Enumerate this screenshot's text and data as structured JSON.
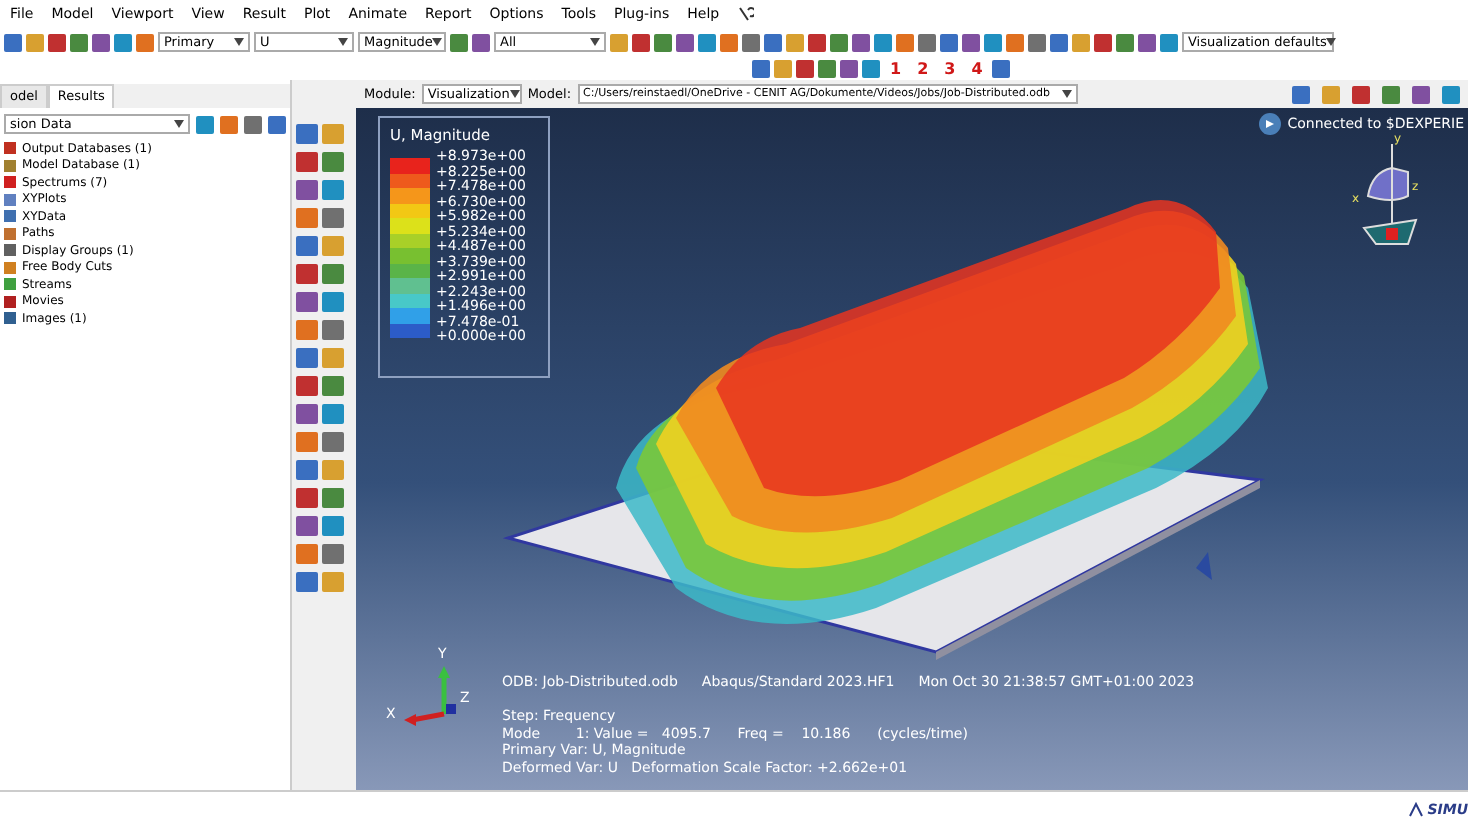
{
  "menu": [
    "File",
    "Model",
    "Viewport",
    "View",
    "Result",
    "Plot",
    "Animate",
    "Report",
    "Options",
    "Tools",
    "Plug-ins",
    "Help"
  ],
  "toolbar": {
    "step_select": "Primary",
    "variable_select": "U",
    "invariant_select": "Magnitude",
    "selection_select": "All",
    "defaults_select": "Visualization defaults",
    "view_numbers": [
      "1",
      "2",
      "3",
      "4"
    ]
  },
  "context_bar": {
    "module_label": "Module:",
    "module": "Visualization",
    "model_label": "Model:",
    "model": "C:/Users/reinstaedl/OneDrive - CENIT AG/Dokumente/Videos/Jobs/Job-Distributed.odb"
  },
  "tabs": [
    {
      "label": "odel",
      "selected": false
    },
    {
      "label": "Results",
      "selected": true
    }
  ],
  "tree_filter": "sion Data",
  "tree": [
    {
      "label": "Output Databases (1)",
      "color": "#c03020"
    },
    {
      "label": "Model Database (1)",
      "color": "#a08030"
    },
    {
      "label": "Spectrums (7)",
      "color": "#d02020"
    },
    {
      "label": "XYPlots",
      "color": "#6080c0"
    },
    {
      "label": "XYData",
      "color": "#4070b0"
    },
    {
      "label": "Paths",
      "color": "#c07030"
    },
    {
      "label": "Display Groups (1)",
      "color": "#606060"
    },
    {
      "label": "Free Body Cuts",
      "color": "#d08020"
    },
    {
      "label": "Streams",
      "color": "#40a040"
    },
    {
      "label": "Movies",
      "color": "#b02020"
    },
    {
      "label": "Images (1)",
      "color": "#306090"
    }
  ],
  "viewport": {
    "legend": {
      "title": "U, Magnitude",
      "values": [
        "+8.973e+00",
        "+8.225e+00",
        "+7.478e+00",
        "+6.730e+00",
        "+5.982e+00",
        "+5.234e+00",
        "+4.487e+00",
        "+3.739e+00",
        "+2.991e+00",
        "+2.243e+00",
        "+1.496e+00",
        "+7.478e-01",
        "+0.000e+00"
      ],
      "bands": [
        {
          "color": "#e8231c"
        },
        {
          "color": "#ee5a1c"
        },
        {
          "color": "#f5961a"
        },
        {
          "color": "#f2c814"
        },
        {
          "color": "#dce11a"
        },
        {
          "color": "#a8d028"
        },
        {
          "color": "#78c030"
        },
        {
          "color": "#5ab448"
        },
        {
          "color": "#60c090"
        },
        {
          "color": "#48c8c8"
        },
        {
          "color": "#30a0e8"
        },
        {
          "color": "#2c5cc8"
        }
      ]
    },
    "connection": "Connected to $DEXPERIE",
    "view_cube_axes": [
      "x",
      "y",
      "z"
    ],
    "triad_axes": [
      "Y",
      "X",
      "Z"
    ],
    "info": {
      "odb": "ODB: Job-Distributed.odb",
      "solver": "Abaqus/Standard 2023.HF1",
      "date": "Mon Oct 30 21:38:57 GMT+01:00 2023",
      "step": "Step: Frequency",
      "mode": "Mode        1: Value =   4095.7      Freq =    10.186      (cycles/time)",
      "primary": "Primary Var: U, Magnitude",
      "deformed": "Deformed Var: U   Deformation Scale Factor: +2.662e+01"
    }
  },
  "status_bar": {
    "logo": "SIMU"
  }
}
